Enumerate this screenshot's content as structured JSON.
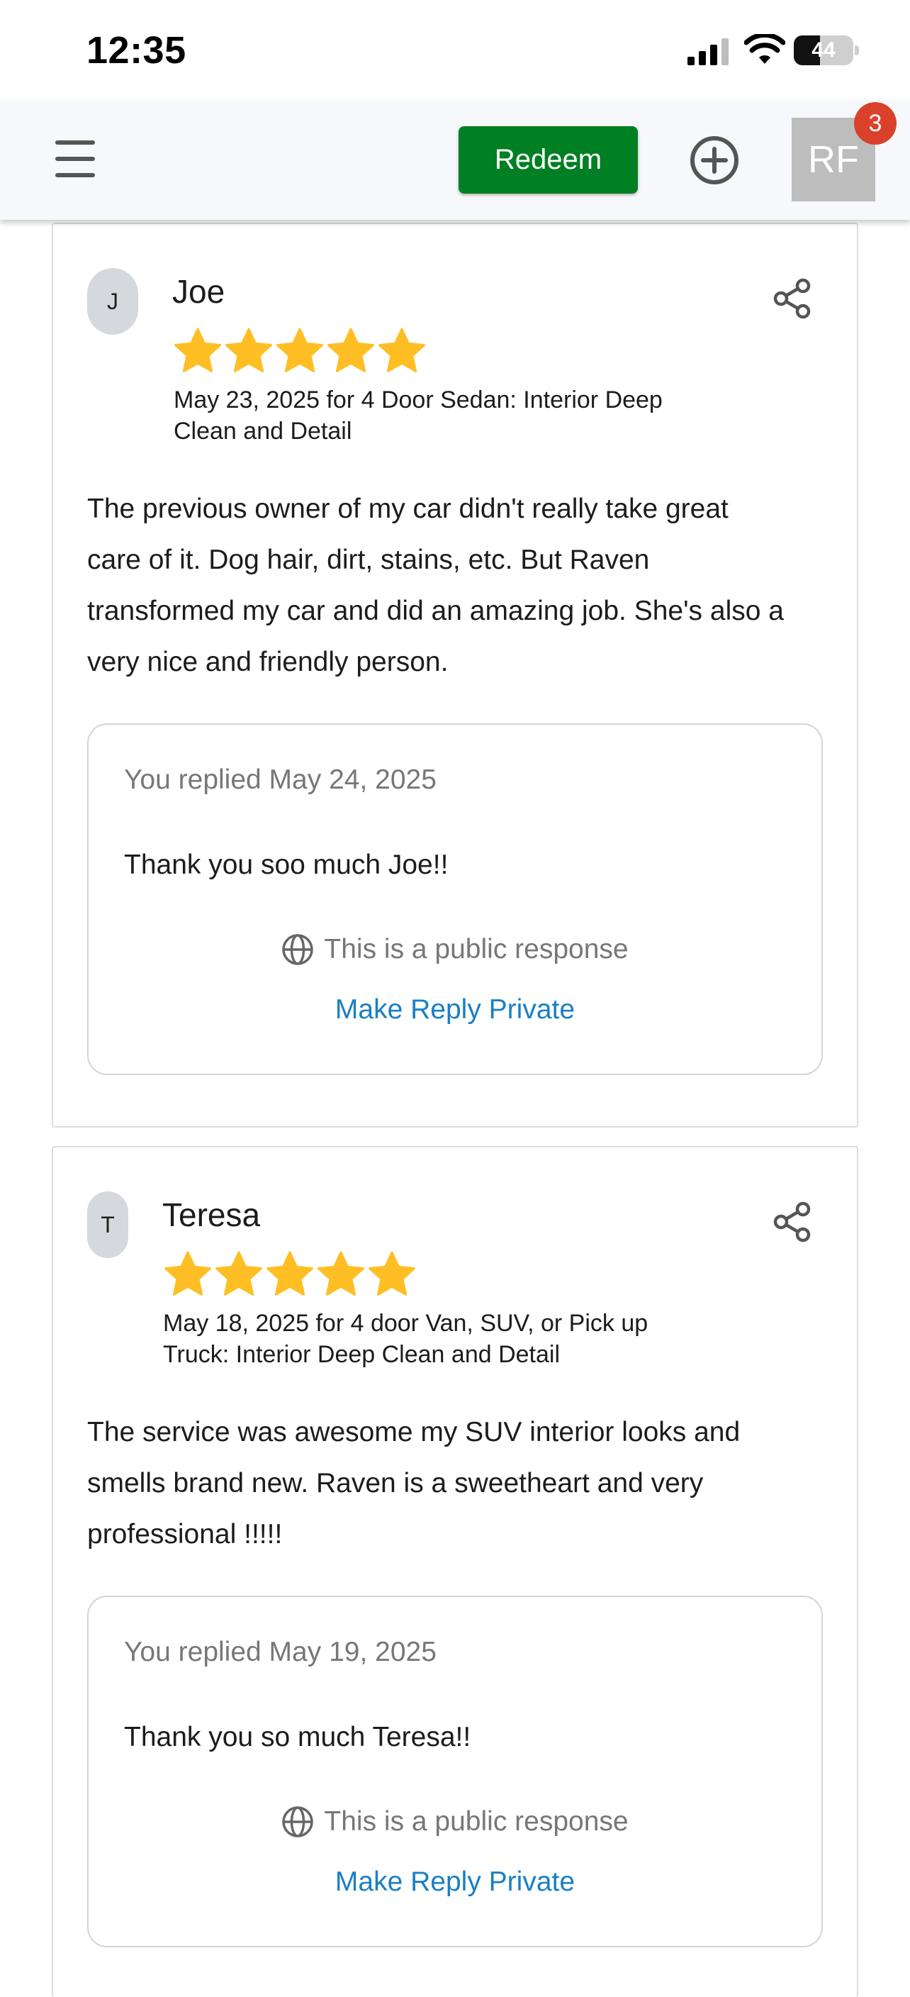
{
  "status_bar": {
    "time": "12:35",
    "battery": "44",
    "battery_level": 0.44
  },
  "header": {
    "menu_icon": "hamburger-menu-icon",
    "redeem_label": "Redeem",
    "add_icon": "plus-circle-icon",
    "avatar_initials": "RF",
    "notification_count": "3"
  },
  "colors": {
    "redeem_green": "#007f23",
    "badge_red": "#d9412b",
    "star_gold": "#ffbf24",
    "link_blue": "#1a7fc4"
  },
  "reviews": [
    {
      "initial": "J",
      "name": "Joe",
      "stars": 5,
      "meta_line1": "May 23, 2025 for 4 Door Sedan: Interior Deep",
      "meta_line2": "Clean and Detail",
      "body_lines": [
        "The previous owner of my car didn't really take great",
        "care of it. Dog hair, dirt, stains, etc. But Raven",
        "transformed my car and did an amazing job. She's also a",
        "very nice and friendly person."
      ],
      "reply": {
        "date": "You replied May 24, 2025",
        "text": "Thank you soo much Joe!!",
        "public_label": "This is a public response",
        "private_link": "Make Reply Private"
      }
    },
    {
      "initial": "T",
      "name": "Teresa",
      "stars": 5,
      "meta_line1": "May 18, 2025 for 4 door Van, SUV, or Pick up",
      "meta_line2": "Truck: Interior Deep Clean and Detail",
      "body_lines": [
        "The service was awesome my SUV interior looks and",
        "smells brand new. Raven is a sweetheart and very",
        "professional !!!!!"
      ],
      "reply": {
        "date": "You replied May 19, 2025",
        "text": "Thank you so much Teresa!!",
        "public_label": "This is a public response",
        "private_link": "Make Reply Private"
      }
    }
  ],
  "icons": {
    "share": "share-icon",
    "globe": "globe-icon",
    "star": "star-icon"
  }
}
